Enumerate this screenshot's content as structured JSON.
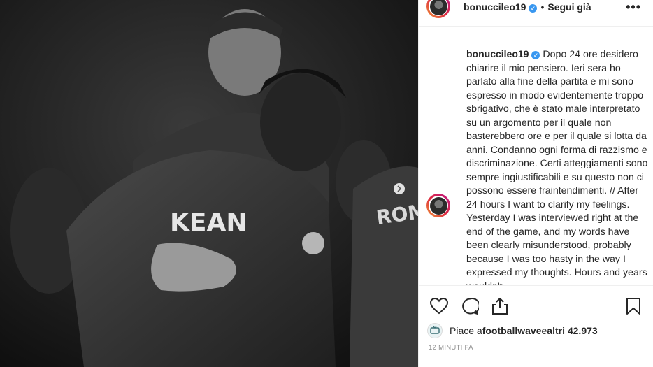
{
  "post": {
    "username": "bonuccileo19",
    "verified_glyph": "✓",
    "separator": "•",
    "follow_status": "Segui già",
    "more_glyph": "•••",
    "caption": "Dopo 24 ore desidero chiarire il mio pensiero. Ieri sera ho parlato alla fine della partita e mi sono espresso in modo evidentemente troppo sbrigativo, che è stato male interpretato su un argomento per il quale non basterebbero ore e per il quale si lotta da anni. Condanno ogni forma di razzismo e discriminazione. Certi atteggiamenti sono sempre ingiustificabili e su questo non ci possono essere fraintendimenti. // After 24 hours I want to clarify my feelings. Yesterday I was interviewed right at the end of the game, and my words have been clearly misunderstood, probably because I was too hasty in the way I expressed my thoughts. Hours and years wouldn't",
    "likes_prefix": "Piace a ",
    "likes_user": "footballwave",
    "likes_middle": " e ",
    "likes_count": "altri 42.973",
    "timestamp": "12 minuti fa"
  },
  "photo": {
    "jersey_name_left": "KEAN",
    "jersey_name_right": "ROMA"
  },
  "icons": {
    "like": "heart-icon",
    "comment": "comment-icon",
    "share": "share-icon",
    "save": "bookmark-icon",
    "more": "more-options-icon",
    "verified": "verified-badge-icon"
  },
  "colors": {
    "verified": "#3897f0",
    "text": "#262626",
    "muted": "#8e8e8e",
    "border": "#efefef"
  }
}
